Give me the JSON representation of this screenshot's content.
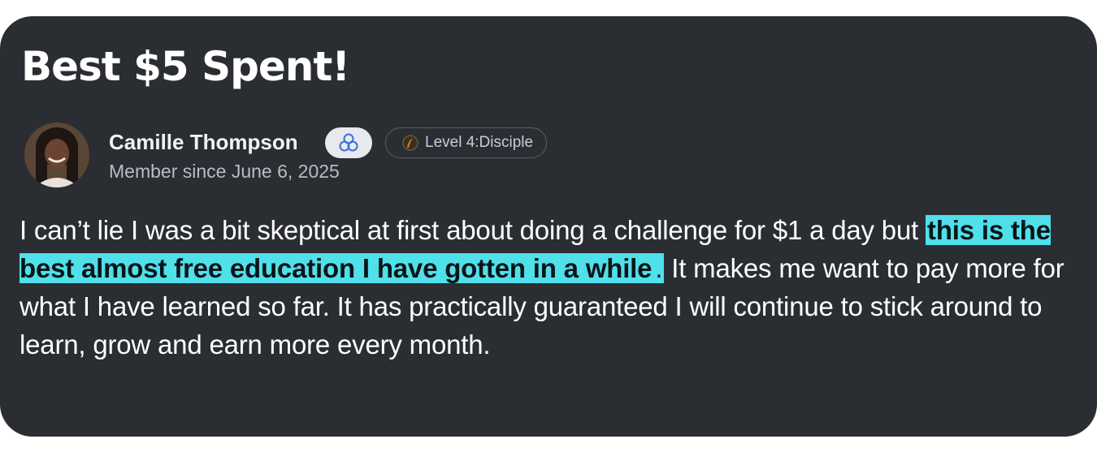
{
  "review": {
    "title": "Best $5 Spent!",
    "author": {
      "name": "Camille Thompson",
      "member_since": "Member since June 6, 2025",
      "level": "Level 4:Disciple",
      "badge_icon": "community-knot-icon",
      "level_icon": "feather-icon",
      "avatar": "user-avatar-photo"
    },
    "body_before": "I can’t lie I was a bit skeptical at first about doing a challenge for $1 a day but ",
    "body_highlight": "this is the best almost free education I have gotten in a while",
    "body_highlight_end": ".",
    "body_after": " It makes me want to pay more for what I have learned so far. It has practically guaranteed I will continue to stick around to learn, grow and earn more every month."
  },
  "colors": {
    "card_background": "#2a2d32",
    "highlight": "#4fe0ea",
    "badge_background": "#e7e9ee",
    "badge_icon": "#3b6fd8"
  }
}
